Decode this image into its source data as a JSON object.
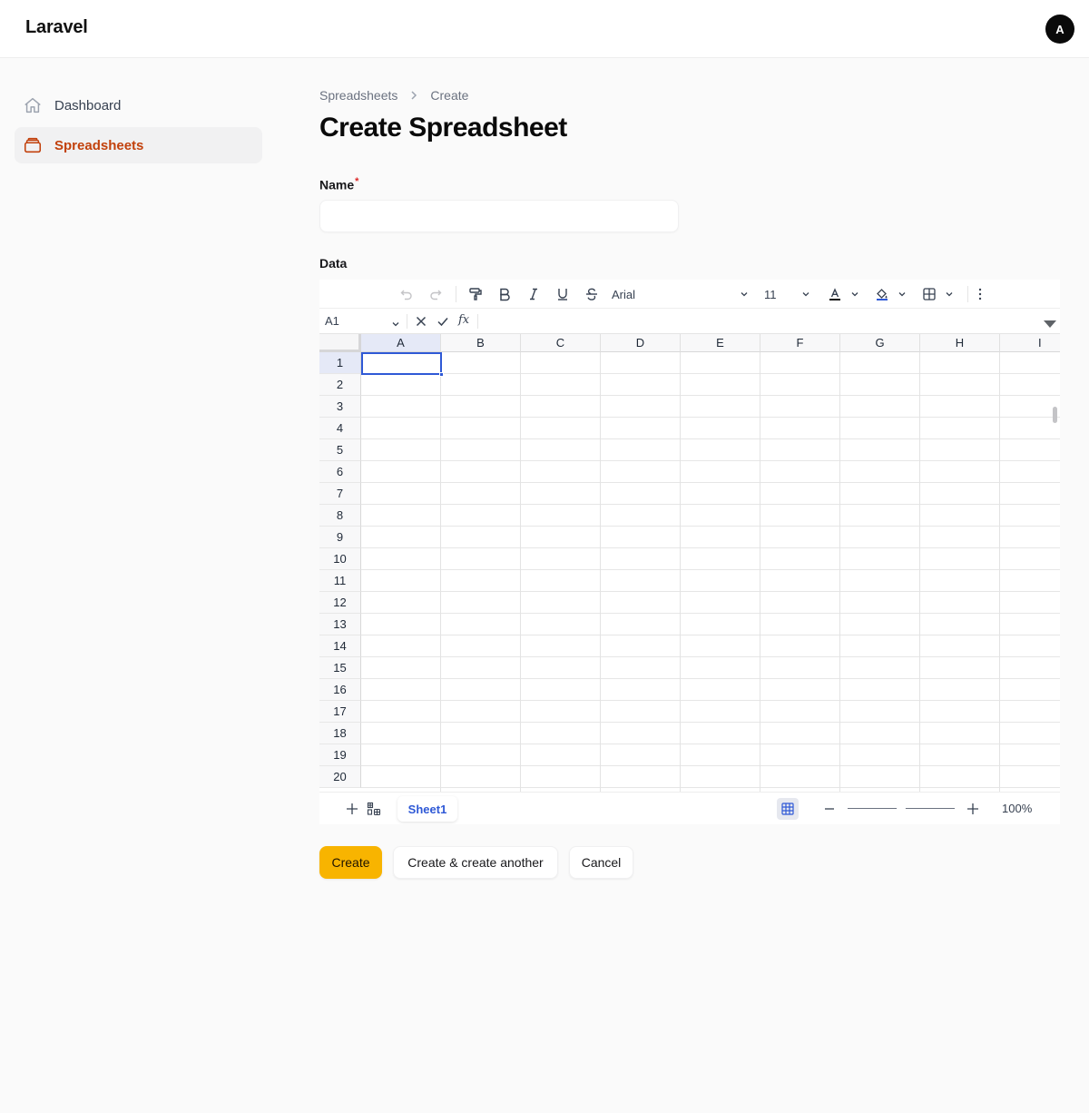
{
  "brand": "Laravel",
  "user_initial": "A",
  "sidebar": {
    "items": [
      {
        "label": "Dashboard",
        "icon": "home-icon"
      },
      {
        "label": "Spreadsheets",
        "icon": "stack-icon"
      }
    ]
  },
  "breadcrumb": [
    "Spreadsheets",
    "Create"
  ],
  "page_title": "Create Spreadsheet",
  "form": {
    "name_label": "Name",
    "required_marker": "*",
    "name_value": "",
    "data_label": "Data"
  },
  "spreadsheet": {
    "font_family": "Arial",
    "font_size": "11",
    "cell_ref": "A1",
    "fx_label": "fx",
    "columns": [
      "A",
      "B",
      "C",
      "D",
      "E",
      "F",
      "G",
      "H",
      "I"
    ],
    "rows": [
      "1",
      "2",
      "3",
      "4",
      "5",
      "6",
      "7",
      "8",
      "9",
      "10",
      "11",
      "12",
      "13",
      "14",
      "15",
      "16",
      "17",
      "18",
      "19",
      "20"
    ],
    "selected_column": "A",
    "selected_row": "1",
    "sheet_tab": "Sheet1",
    "zoom": "100%",
    "accent_color": "#2f59d6"
  },
  "buttons": {
    "create": "Create",
    "create_another": "Create & create another",
    "cancel": "Cancel"
  },
  "colors": {
    "primary": "#f8b400",
    "active_nav": "#c2410c"
  }
}
